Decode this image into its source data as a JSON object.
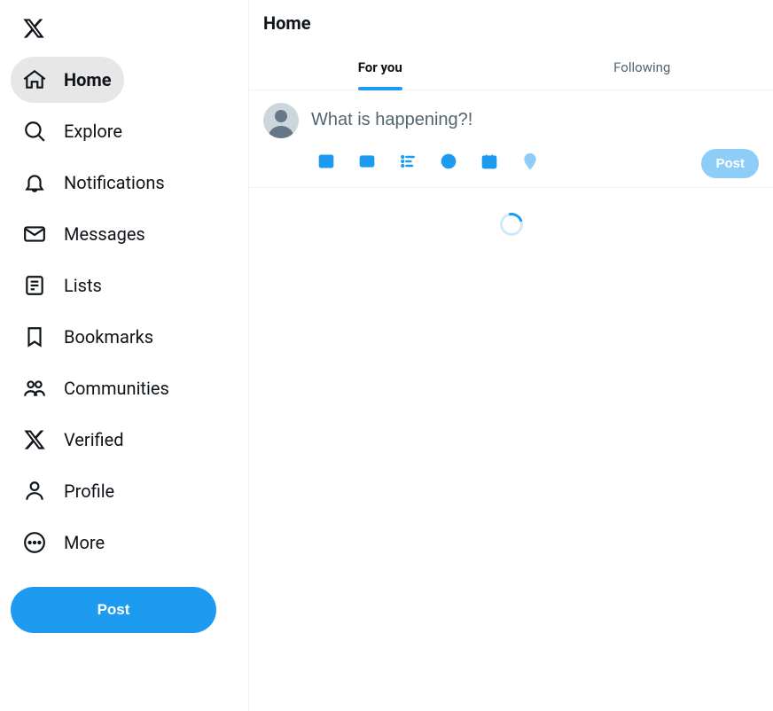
{
  "sidebar": {
    "items": [
      {
        "label": "Home",
        "active": true
      },
      {
        "label": "Explore"
      },
      {
        "label": "Notifications"
      },
      {
        "label": "Messages"
      },
      {
        "label": "Lists"
      },
      {
        "label": "Bookmarks"
      },
      {
        "label": "Communities"
      },
      {
        "label": "Verified"
      },
      {
        "label": "Profile"
      },
      {
        "label": "More"
      }
    ],
    "post_label": "Post"
  },
  "header": {
    "title": "Home",
    "tabs": [
      {
        "label": "For you",
        "active": true
      },
      {
        "label": "Following"
      }
    ]
  },
  "composer": {
    "placeholder": "What is happening?!",
    "post_label": "Post"
  },
  "colors": {
    "accent": "#1d9bf0",
    "text": "#0f1419",
    "muted": "#536471",
    "border": "#eff3f4"
  }
}
